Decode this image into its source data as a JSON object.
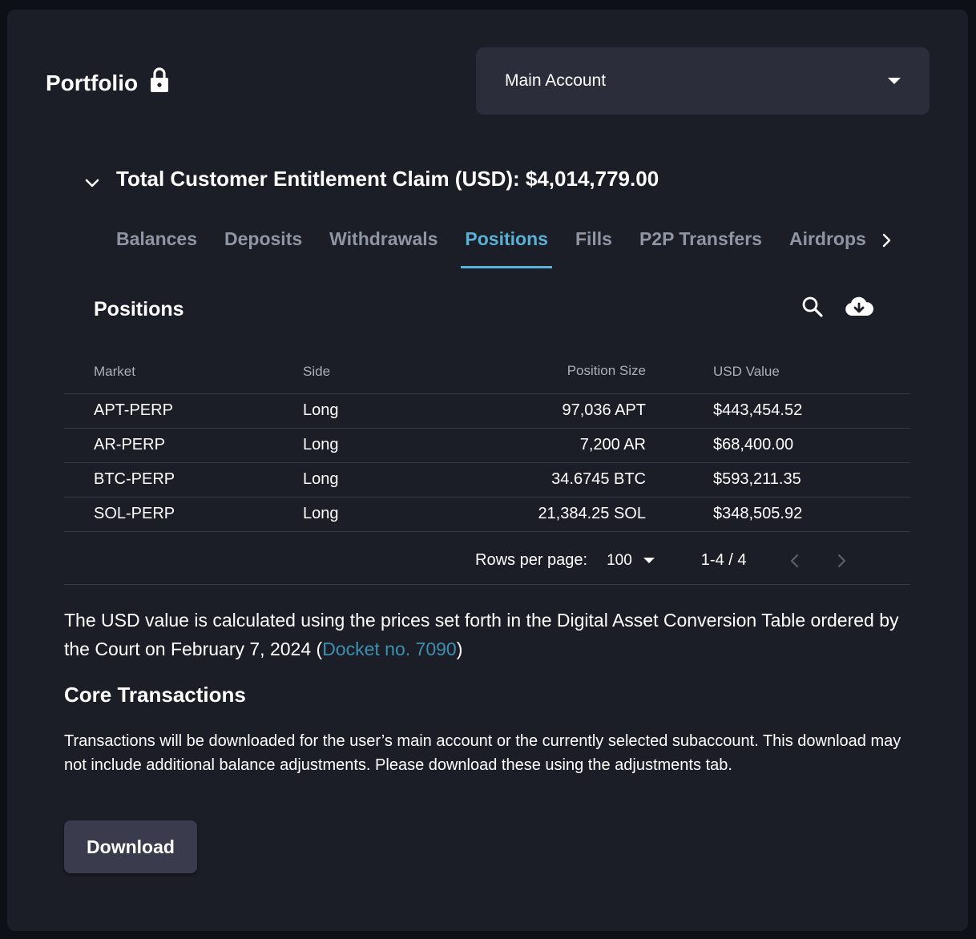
{
  "header": {
    "title": "Portfolio",
    "account_select": {
      "value": "Main Account"
    }
  },
  "claim": {
    "label": "Total Customer Entitlement Claim (USD): $4,014,779.00"
  },
  "tabs": [
    {
      "label": "Balances",
      "active": false
    },
    {
      "label": "Deposits",
      "active": false
    },
    {
      "label": "Withdrawals",
      "active": false
    },
    {
      "label": "Positions",
      "active": true
    },
    {
      "label": "Fills",
      "active": false
    },
    {
      "label": "P2P Transfers",
      "active": false
    },
    {
      "label": "Airdrops",
      "active": false
    }
  ],
  "positions": {
    "title": "Positions",
    "columns": {
      "market": "Market",
      "side": "Side",
      "size": "Position Size",
      "usd": "USD Value"
    },
    "rows": [
      {
        "market": "APT-PERP",
        "side": "Long",
        "size": "97,036 APT",
        "usd": "$443,454.52"
      },
      {
        "market": "AR-PERP",
        "side": "Long",
        "size": "7,200 AR",
        "usd": "$68,400.00"
      },
      {
        "market": "BTC-PERP",
        "side": "Long",
        "size": "34.6745 BTC",
        "usd": "$593,211.35"
      },
      {
        "market": "SOL-PERP",
        "side": "Long",
        "size": "21,384.25 SOL",
        "usd": "$348,505.92"
      }
    ],
    "pagination": {
      "rows_label": "Rows per page:",
      "rows_value": "100",
      "range": "1-4 / 4"
    }
  },
  "note": {
    "text_before": "The USD value is calculated using the prices set forth in the Digital Asset Conversion Table ordered by the Court on February 7, 2024 (",
    "link": "Docket no. 7090",
    "text_after": ")"
  },
  "core": {
    "title": "Core Transactions",
    "description": "Transactions will be downloaded for the user’s main account or the currently selected subaccount. This download may not include additional balance adjustments. Please download these using the adjustments tab.",
    "download_label": "Download"
  },
  "colors": {
    "accent": "#5ab1d6",
    "link": "#3e8fb0",
    "card": "#1c1e27",
    "background": "#0d1117"
  }
}
